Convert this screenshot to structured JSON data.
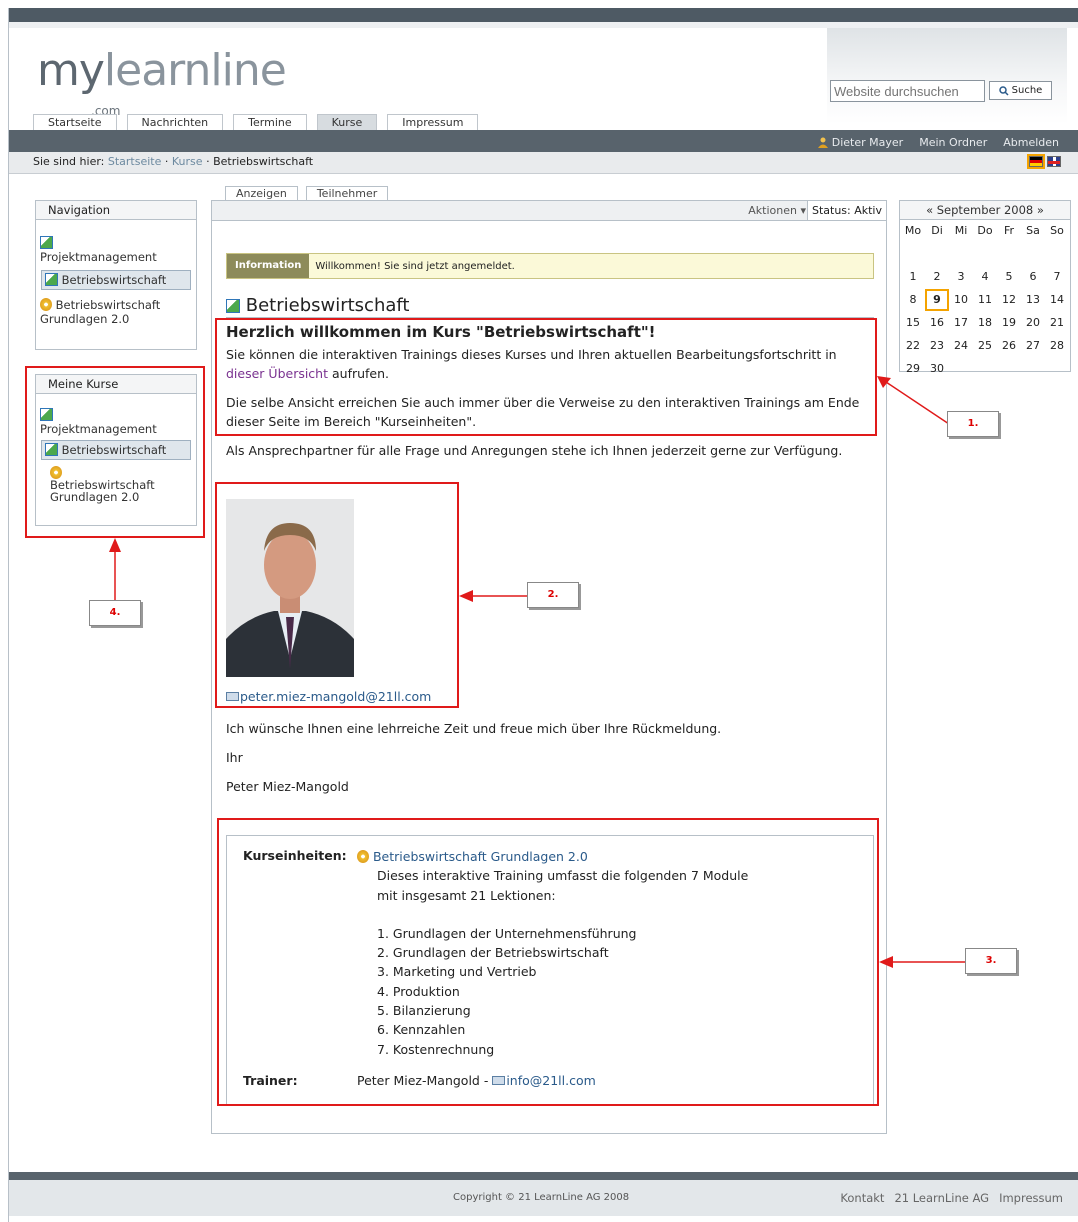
{
  "header": {
    "logo": {
      "part1": "my",
      "part2": "learnline",
      "suffix": ".com"
    },
    "search": {
      "placeholder": "Website durchsuchen",
      "button_label": "Suche"
    },
    "tabs": [
      {
        "label": "Startseite",
        "active": false
      },
      {
        "label": "Nachrichten",
        "active": false
      },
      {
        "label": "Termine",
        "active": false
      },
      {
        "label": "Kurse",
        "active": true
      },
      {
        "label": "Impressum",
        "active": false
      }
    ],
    "userbar": {
      "user": "Dieter Mayer",
      "folder": "Mein Ordner",
      "logout": "Abmelden"
    },
    "breadcrumb": {
      "prefix": "Sie sind hier:",
      "items": [
        "Startseite",
        "Kurse",
        "Betriebswirtschaft"
      ],
      "separator": "·"
    }
  },
  "sidebar": {
    "navigation": {
      "title": "Navigation",
      "items": [
        {
          "label": "Projektmanagement",
          "icon": "course-icon",
          "selected": false
        },
        {
          "label": "Betriebswirtschaft",
          "icon": "course-icon",
          "selected": true
        },
        {
          "label": "Betriebswirtschaft Grundlagen 2.0",
          "icon": "cd-icon",
          "selected": false
        }
      ]
    },
    "my_courses": {
      "title": "Meine Kurse",
      "items": [
        {
          "label": "Projektmanagement",
          "icon": "course-icon",
          "selected": false
        },
        {
          "label": "Betriebswirtschaft",
          "icon": "course-icon",
          "selected": true
        },
        {
          "label": "Betriebswirtschaft Grundlagen 2.0",
          "icon": "cd-icon",
          "selected": false
        }
      ]
    }
  },
  "main": {
    "tabs": [
      {
        "label": "Anzeigen",
        "active": true
      },
      {
        "label": "Teilnehmer",
        "active": false
      }
    ],
    "actions_label": "Aktionen ▾",
    "status_label": "Status: Aktiv",
    "info": {
      "label": "Information",
      "message": "Willkommen! Sie sind jetzt angemeldet."
    },
    "title": "Betriebswirtschaft",
    "welcome_heading": "Herzlich willkommen im Kurs \"Betriebswirtschaft\"!",
    "p1_before": "Sie können die interaktiven Trainings dieses Kurses und Ihren aktuellen Bearbeitungsfortschritt in ",
    "p1_link": "dieser Übersicht",
    "p1_after": " aufrufen.",
    "p2": "Die selbe Ansicht erreichen Sie auch immer über die Verweise zu den interaktiven Trainings am Ende dieser Seite im Bereich \"Kurseinheiten\".",
    "p3": "Als Ansprechpartner für alle Frage und Anregungen stehe ich Ihnen jederzeit gerne zur Verfügung.",
    "email": "peter.miez-mangold@21ll.com",
    "p4": "Ich wünsche Ihnen eine lehrreiche Zeit und freue mich über Ihre Rückmeldung.",
    "sign1": "Ihr",
    "sign2": "Peter Miez-Mangold",
    "units": {
      "label": "Kurseinheiten:",
      "link": "Betriebswirtschaft Grundlagen 2.0",
      "desc1": "Dieses interaktive Training umfasst die folgenden 7 Module",
      "desc2": "mit insgesamt 21 Lektionen:",
      "modules": [
        "1. Grundlagen der Unternehmensführung",
        "2. Grundlagen der Betriebswirtschaft",
        "3. Marketing und Vertrieb",
        "4. Produktion",
        "5. Bilanzierung",
        "6. Kennzahlen",
        "7. Kostenrechnung"
      ],
      "trainer_label": "Trainer:",
      "trainer_name": "Peter Miez-Mangold - ",
      "trainer_email": "info@21ll.com"
    }
  },
  "calendar": {
    "title": "« September 2008 »",
    "weekdays": [
      "Mo",
      "Di",
      "Mi",
      "Do",
      "Fr",
      "Sa",
      "So"
    ],
    "today": "9"
  },
  "annotations": [
    "1.",
    "2.",
    "3.",
    "4."
  ],
  "footer": {
    "copyright": "Copyright © 21 LearnLine AG 2008",
    "links": [
      "Kontakt",
      "21 LearnLine AG",
      "Impressum"
    ]
  },
  "colors": {
    "annotation": "#e01a1a",
    "header_bar": "#58636c",
    "highlight": "#f4a300"
  }
}
